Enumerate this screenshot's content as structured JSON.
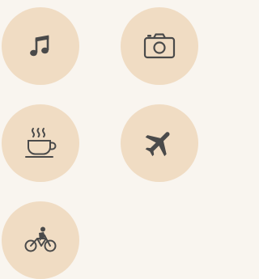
{
  "theme": {
    "background": "#f9f5ef",
    "chip_fill": "#f0dcc3",
    "icon_color": "#4a4a4a"
  },
  "interests": [
    {
      "icon": "music-note-icon"
    },
    {
      "icon": "camera-icon"
    },
    {
      "icon": "coffee-cup-icon"
    },
    {
      "icon": "airplane-icon"
    },
    {
      "icon": "bicycle-icon"
    }
  ]
}
